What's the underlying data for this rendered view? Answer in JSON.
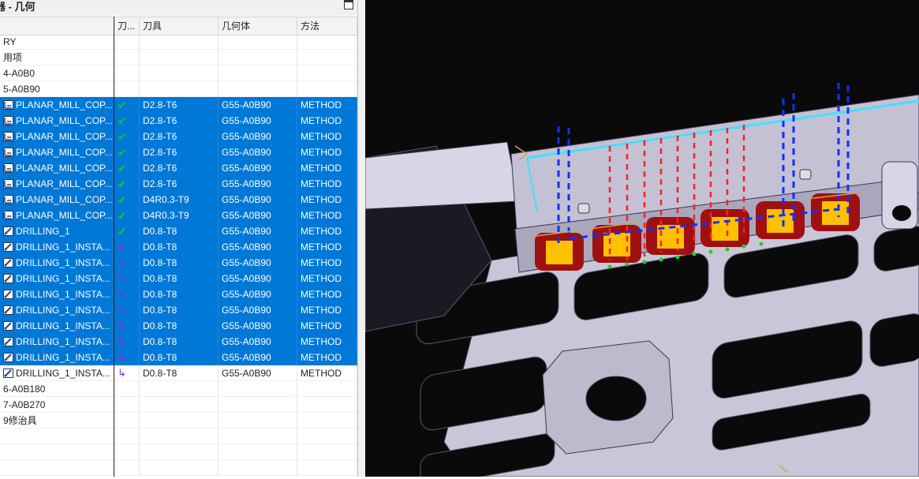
{
  "panel": {
    "title": "器 - 几何",
    "columns": [
      "",
      "刀...",
      "刀具",
      "几何体",
      "方法"
    ]
  },
  "rows": [
    {
      "name": "RY",
      "status": "",
      "tool": "",
      "geometry": "",
      "method": "",
      "selected": false
    },
    {
      "name": "用项",
      "status": "",
      "tool": "",
      "geometry": "",
      "method": "",
      "selected": false
    },
    {
      "name": "4-A0B0",
      "status": "",
      "tool": "",
      "geometry": "",
      "method": "",
      "selected": false
    },
    {
      "name": "5-A0B90",
      "status": "",
      "tool": "",
      "geometry": "",
      "method": "",
      "selected": false
    },
    {
      "name": "PLANAR_MILL_COP...",
      "icon": "planar-mill-icon",
      "status": "check",
      "tool": "D2.8-T6",
      "geometry": "G55-A0B90",
      "method": "METHOD",
      "selected": true
    },
    {
      "name": "PLANAR_MILL_COP...",
      "icon": "planar-mill-icon",
      "status": "check",
      "tool": "D2.8-T6",
      "geometry": "G55-A0B90",
      "method": "METHOD",
      "selected": true
    },
    {
      "name": "PLANAR_MILL_COP...",
      "icon": "planar-mill-icon",
      "status": "check",
      "tool": "D2.8-T6",
      "geometry": "G55-A0B90",
      "method": "METHOD",
      "selected": true
    },
    {
      "name": "PLANAR_MILL_COP...",
      "icon": "planar-mill-icon",
      "status": "check",
      "tool": "D2.8-T6",
      "geometry": "G55-A0B90",
      "method": "METHOD",
      "selected": true
    },
    {
      "name": "PLANAR_MILL_COP...",
      "icon": "planar-mill-icon",
      "status": "check",
      "tool": "D2.8-T6",
      "geometry": "G55-A0B90",
      "method": "METHOD",
      "selected": true
    },
    {
      "name": "PLANAR_MILL_COP...",
      "icon": "planar-mill-icon",
      "status": "check",
      "tool": "D2.8-T6",
      "geometry": "G55-A0B90",
      "method": "METHOD",
      "selected": true
    },
    {
      "name": "PLANAR_MILL_COP...",
      "icon": "planar-mill-icon",
      "status": "check",
      "tool": "D4R0.3-T9",
      "geometry": "G55-A0B90",
      "method": "METHOD",
      "selected": true
    },
    {
      "name": "PLANAR_MILL_COP...",
      "icon": "planar-mill-icon",
      "status": "check",
      "tool": "D4R0.3-T9",
      "geometry": "G55-A0B90",
      "method": "METHOD",
      "selected": true
    },
    {
      "name": "DRILLING_1",
      "icon": "drilling-icon",
      "status": "check",
      "tool": "D0.8-T8",
      "geometry": "G55-A0B90",
      "method": "METHOD",
      "selected": true
    },
    {
      "name": "DRILLING_1_INSTA...",
      "icon": "drilling-icon",
      "status": "arrow",
      "tool": "D0.8-T8",
      "geometry": "G55-A0B90",
      "method": "METHOD",
      "selected": true
    },
    {
      "name": "DRILLING_1_INSTA...",
      "icon": "drilling-icon",
      "status": "arrow",
      "tool": "D0.8-T8",
      "geometry": "G55-A0B90",
      "method": "METHOD",
      "selected": true
    },
    {
      "name": "DRILLING_1_INSTA...",
      "icon": "drilling-icon",
      "status": "arrow",
      "tool": "D0.8-T8",
      "geometry": "G55-A0B90",
      "method": "METHOD",
      "selected": true
    },
    {
      "name": "DRILLING_1_INSTA...",
      "icon": "drilling-icon",
      "status": "arrow",
      "tool": "D0.8-T8",
      "geometry": "G55-A0B90",
      "method": "METHOD",
      "selected": true
    },
    {
      "name": "DRILLING_1_INSTA...",
      "icon": "drilling-icon",
      "status": "arrow",
      "tool": "D0.8-T8",
      "geometry": "G55-A0B90",
      "method": "METHOD",
      "selected": true
    },
    {
      "name": "DRILLING_1_INSTA...",
      "icon": "drilling-icon",
      "status": "arrow",
      "tool": "D0.8-T8",
      "geometry": "G55-A0B90",
      "method": "METHOD",
      "selected": true
    },
    {
      "name": "DRILLING_1_INSTA...",
      "icon": "drilling-icon",
      "status": "arrow",
      "tool": "D0.8-T8",
      "geometry": "G55-A0B90",
      "method": "METHOD",
      "selected": true
    },
    {
      "name": "DRILLING_1_INSTA...",
      "icon": "drilling-icon",
      "status": "arrow",
      "tool": "D0.8-T8",
      "geometry": "G55-A0B90",
      "method": "METHOD",
      "selected": true
    },
    {
      "name": "DRILLING_1_INSTA...",
      "icon": "drilling-icon",
      "status": "arrow",
      "tool": "D0.8-T8",
      "geometry": "G55-A0B90",
      "method": "METHOD",
      "selected": false
    },
    {
      "name": "6-A0B180",
      "status": "",
      "tool": "",
      "geometry": "",
      "method": "",
      "selected": false
    },
    {
      "name": "7-A0B270",
      "status": "",
      "tool": "",
      "geometry": "",
      "method": "",
      "selected": false
    },
    {
      "name": "9修治具",
      "status": "",
      "tool": "",
      "geometry": "",
      "method": "",
      "selected": false
    },
    {
      "name": "",
      "status": "",
      "tool": "",
      "geometry": "",
      "method": "",
      "selected": false
    },
    {
      "name": "",
      "status": "",
      "tool": "",
      "geometry": "",
      "method": "",
      "selected": false
    },
    {
      "name": "",
      "status": "",
      "tool": "",
      "geometry": "",
      "method": "",
      "selected": false
    }
  ],
  "colors": {
    "selection": "#0078d7",
    "check": "#22c322",
    "arrow": "#8a2be2",
    "viewport_bg": "#0a0a0a",
    "part": "#c9c6d9",
    "toolpath_red": "#ff2020",
    "toolpath_blue": "#1030ff",
    "pocket_yellow": "#ffc000",
    "cyan_edge": "#40e0ff"
  }
}
